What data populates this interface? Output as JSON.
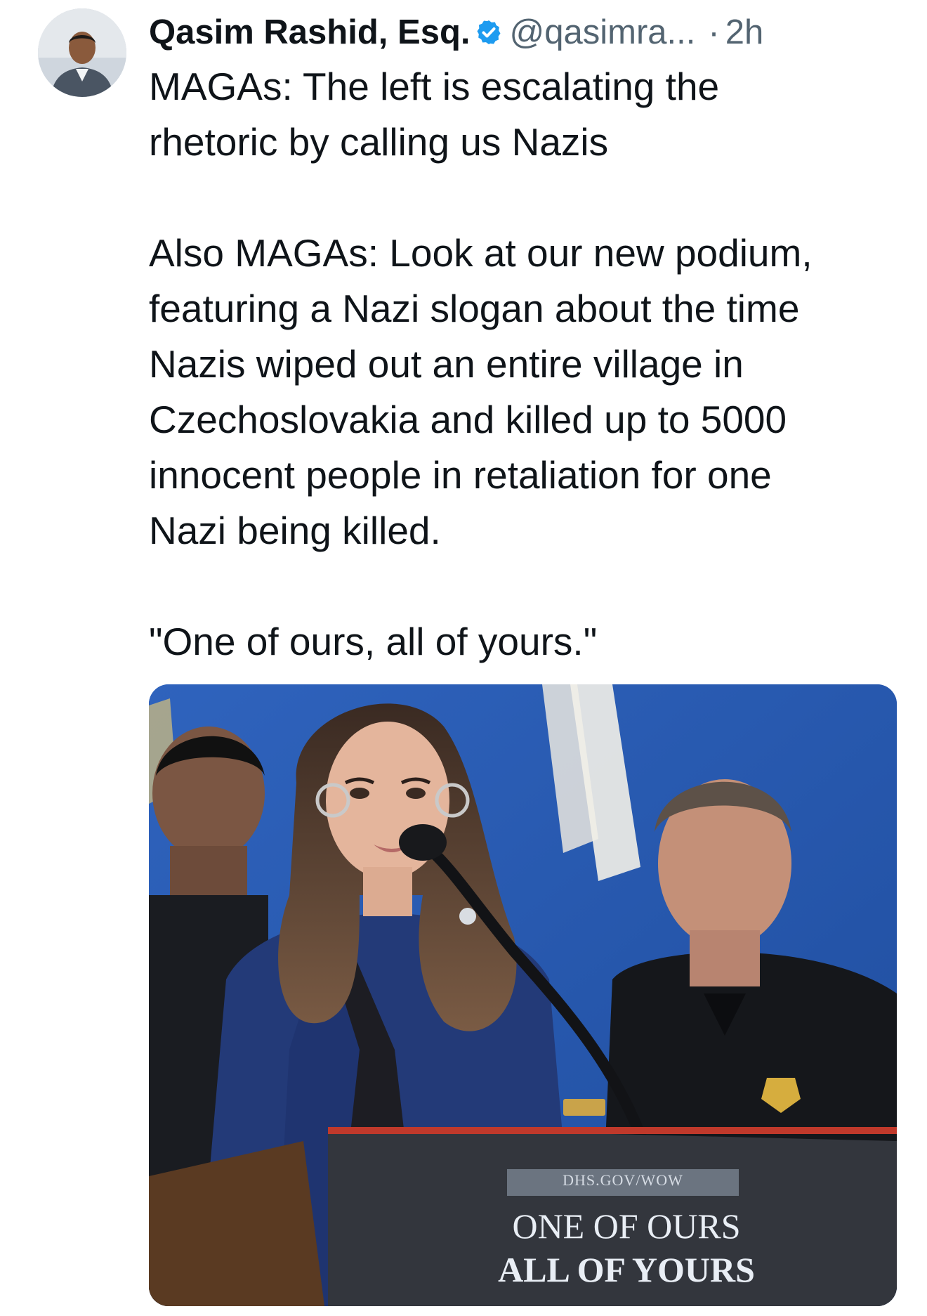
{
  "author": {
    "name": "Qasim Rashid, Esq.",
    "handle": "@qasimra...",
    "separator": "·",
    "time": "2h",
    "avatar_icon": "person-avatar",
    "verified_icon": "verified-badge-icon",
    "verified_color": "#1d9bf0"
  },
  "tweet": {
    "text": "MAGAs: The left is escalating the\nrhetoric by calling us Nazis\n\nAlso MAGAs: Look at our new podium,\nfeaturing a Nazi slogan about the time\nNazis wiped out an entire village in\nCzechoslovakia and killed up to 5000\ninnocent people in retaliation for one\nNazi being killed.\n\n\"One of ours, all of yours.\""
  },
  "media": {
    "podium_url": "DHS.GOV/WOW",
    "podium_line1": "ONE OF OURS",
    "podium_line2": "ALL OF YOURS"
  },
  "colors": {
    "text_primary": "#0f1419",
    "text_secondary": "#536471",
    "backdrop_blue": "#2f5fb3",
    "podium_dark": "#33363d",
    "podium_stripe": "#c0392b"
  }
}
